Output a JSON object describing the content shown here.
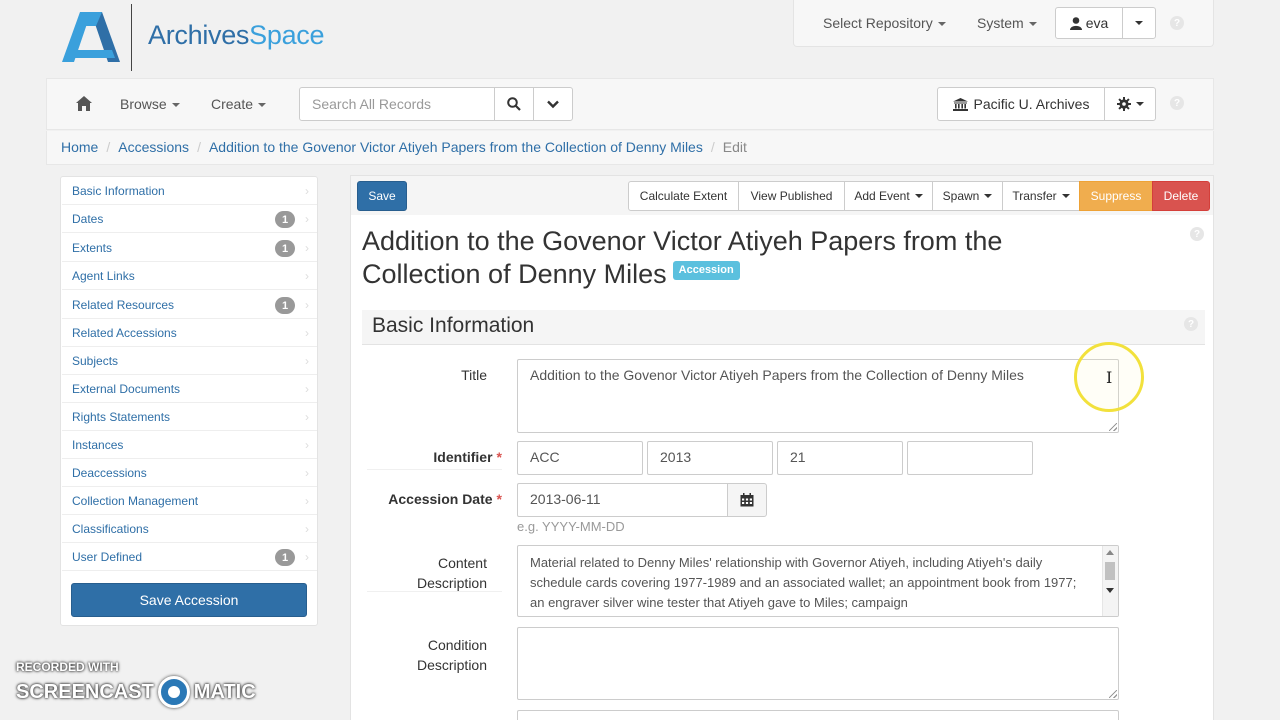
{
  "app": {
    "logo_part1": "Archives",
    "logo_part2": "Space",
    "brand_dark": "#2f6fa7",
    "brand_light": "#3aa0dc"
  },
  "topnav": {
    "select_repository": "Select Repository",
    "system": "System",
    "user": "eva",
    "help_icon": "question-circle-icon"
  },
  "toolbar": {
    "home_icon": "home-icon",
    "browse": "Browse",
    "create": "Create",
    "search_placeholder": "Search All Records",
    "repository": "Pacific U. Archives",
    "settings_icon": "gear-icon"
  },
  "breadcrumb": {
    "items": [
      "Home",
      "Accessions",
      "Addition to the Govenor Victor Atiyeh Papers from the Collection of Denny Miles"
    ],
    "current": "Edit"
  },
  "sidebar": {
    "items": [
      {
        "label": "Basic Information",
        "badge": ""
      },
      {
        "label": "Dates",
        "badge": "1"
      },
      {
        "label": "Extents",
        "badge": "1"
      },
      {
        "label": "Agent Links",
        "badge": ""
      },
      {
        "label": "Related Resources",
        "badge": "1"
      },
      {
        "label": "Related Accessions",
        "badge": ""
      },
      {
        "label": "Subjects",
        "badge": ""
      },
      {
        "label": "External Documents",
        "badge": ""
      },
      {
        "label": "Rights Statements",
        "badge": ""
      },
      {
        "label": "Instances",
        "badge": ""
      },
      {
        "label": "Deaccessions",
        "badge": ""
      },
      {
        "label": "Collection Management",
        "badge": ""
      },
      {
        "label": "Classifications",
        "badge": ""
      },
      {
        "label": "User Defined",
        "badge": "1"
      }
    ],
    "save_button": "Save Accession"
  },
  "actions": {
    "save": "Save",
    "calculate_extent": "Calculate Extent",
    "view_published": "View Published",
    "add_event": "Add Event",
    "spawn": "Spawn",
    "transfer": "Transfer",
    "suppress": "Suppress",
    "delete": "Delete",
    "suppress_color": "#f0ad4e",
    "delete_color": "#d9534f"
  },
  "record": {
    "title": "Addition to the Govenor Victor Atiyeh Papers from the Collection of Denny Miles",
    "type_label": "Accession"
  },
  "form": {
    "section_title": "Basic Information",
    "title_label": "Title",
    "title_value": "Addition to the Govenor Victor Atiyeh Papers from the Collection of Denny Miles",
    "identifier_label": "Identifier",
    "identifier_parts": [
      "ACC",
      "2013",
      "21",
      ""
    ],
    "accession_date_label": "Accession Date",
    "accession_date_value": "2013-06-11",
    "accession_date_hint": "e.g. YYYY-MM-DD",
    "calendar_icon": "calendar-icon",
    "content_description_label": "Content Description",
    "content_description_value": "Material related to Denny Miles' relationship with Governor Atiyeh, including Atiyeh's daily schedule cards covering 1977-1989 and an associated wallet; an appointment book from 1977; an engraver silver wine tester that Atiyeh gave to Miles; campaign",
    "condition_description_label": "Condition Description",
    "condition_description_value": ""
  },
  "watermark": {
    "recorded_with": "RECORDED WITH",
    "brand_left": "SCREENCAST",
    "brand_right": "MATIC"
  }
}
